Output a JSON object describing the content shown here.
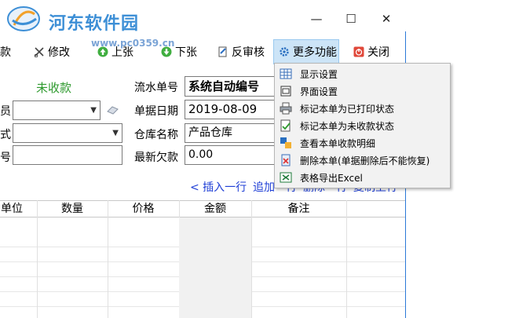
{
  "watermark": {
    "title": "河东软件园",
    "url": "www.pc0359.cn"
  },
  "window": {
    "minimize": "—",
    "maximize": "☐",
    "close": "✕"
  },
  "toolbar": {
    "partial_left": "款",
    "edit": "修改",
    "prev": "上张",
    "next": "下张",
    "unaudit": "反审核",
    "more": "更多功能",
    "close": "关闭"
  },
  "form": {
    "status": "未收款",
    "serial_label": "流水单号",
    "serial_value": "系统自动编号",
    "date_label": "单据日期",
    "date_value": "2019-08-09",
    "warehouse_label": "仓库名称",
    "warehouse_value": "产品仓库",
    "arrears_label": "最新欠款",
    "arrears_value": "0.00",
    "left_label_1": "员",
    "left_label_2": "式",
    "left_label_3": "号"
  },
  "row_actions": {
    "insert": "< 插入一行",
    "append": "追加一行",
    "delete": "删除一行",
    "copy": "复制上行"
  },
  "grid": {
    "headers": [
      "单位",
      "数量",
      "价格",
      "金额",
      "备注"
    ]
  },
  "menu": {
    "items": [
      "显示设置",
      "界面设置",
      "标记本单为已打印状态",
      "标记本单为未收款状态",
      "查看本单收款明细",
      "删除本单(单据删除后不能恢复)",
      "表格导出Excel"
    ]
  },
  "colors": {
    "link": "#1f3fd6",
    "status_green": "#2e9a2e",
    "menu_bg": "#f2f2f2"
  }
}
